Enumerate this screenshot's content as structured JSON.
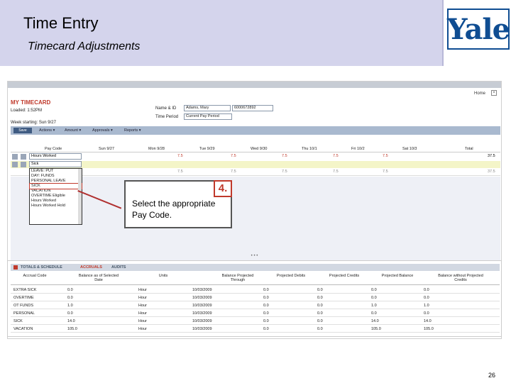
{
  "header": {
    "title": "Time Entry",
    "subtitle": "Timecard Adjustments",
    "logo_text": "Yale"
  },
  "app": {
    "home_link": "Home",
    "timecard_title": "MY TIMECARD",
    "loaded": "Loaded: 1:52PM",
    "name_label": "Name & ID",
    "name_value": "Adams, Mary",
    "id_value": "6000672892",
    "time_period_label": "Time Period",
    "time_period_value": "Current Pay Period",
    "week_label": "Week starting: Sun 9/27",
    "toolbar": {
      "save": "Save",
      "actions": "Actions ▾",
      "amount": "Amount ▾",
      "approvals": "Approvals ▾",
      "reports": "Reports ▾"
    },
    "grid_headers": [
      "Pay Code",
      "Sun 9/27",
      "Mon 9/28",
      "Tue 9/29",
      "Wed 9/30",
      "Thu 10/1",
      "Fri 10/2",
      "Sat 10/3",
      "Total"
    ],
    "row1": {
      "code": "Hours Worked",
      "values": [
        "",
        "7.5",
        "7.5",
        "7.5",
        "7.5",
        "7.5",
        "",
        "37.5"
      ]
    },
    "row2": {
      "code": "Sick"
    },
    "row3": {
      "values": [
        "",
        "7.5",
        "7.5",
        "7.5",
        "7.5",
        "7.5",
        "",
        "37.5"
      ]
    },
    "dropdown_items": [
      "LEAVE: PUT",
      "DAY: FUNDS",
      "PERSONAL LEAVE",
      "SICK",
      "VACATION",
      "OVERTIME Eligible",
      "Hours Worked",
      "Hours Worked Hold"
    ]
  },
  "callout": {
    "number": "4.",
    "line1": "Select the appropriate",
    "line2": "Pay Code."
  },
  "splitter": "• • •",
  "bottom": {
    "tabs": [
      "TOTALS & SCHEDULE",
      "ACCRUALS",
      "AUDITS"
    ],
    "headers": [
      "Accrual Code",
      "Balance as of Selected Date",
      "Units",
      "Balance Projected Through",
      "Projected Debits",
      "Projected Credits",
      "Projected Balance",
      "Balance without Projected Credits"
    ],
    "rows": [
      [
        "EXTRA SICK",
        "0.0",
        "Hour",
        "10/03/2009",
        "0.0",
        "0.0",
        "0.0",
        "0.0"
      ],
      [
        "OVERTIME",
        "0.0",
        "Hour",
        "10/03/2009",
        "0.0",
        "0.0",
        "0.0",
        "0.0"
      ],
      [
        "OT FUNDS",
        "1.0",
        "Hour",
        "10/03/2009",
        "0.0",
        "0.0",
        "1.0",
        "1.0"
      ],
      [
        "PERSONAL",
        "0.0",
        "Hour",
        "10/03/2009",
        "0.0",
        "0.0",
        "0.0",
        "0.0"
      ],
      [
        "SICK",
        "14.0",
        "Hour",
        "10/03/2009",
        "0.0",
        "0.0",
        "14.0",
        "14.0"
      ],
      [
        "VACATION",
        "105.0",
        "Hour",
        "10/03/2009",
        "0.0",
        "0.0",
        "105.0",
        "105.0"
      ]
    ]
  },
  "page_number": "26",
  "colors": {
    "header_bg": "#d4d4ec",
    "accent_red": "#c0392b",
    "yale_blue": "#0f4d92"
  }
}
